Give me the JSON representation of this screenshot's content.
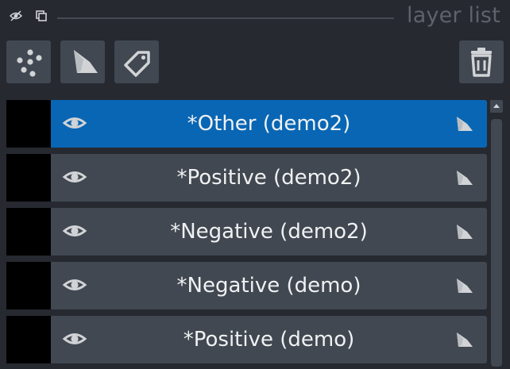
{
  "panel": {
    "title": "layer list",
    "header_icons": [
      "visibility-toggle-icon",
      "float-window-icon"
    ]
  },
  "toolbar": {
    "buttons": [
      {
        "name": "new-points-layer-button",
        "icon": "points-icon"
      },
      {
        "name": "new-shapes-layer-button",
        "icon": "shape-polygon-icon"
      },
      {
        "name": "new-labels-layer-button",
        "icon": "tag-icon"
      }
    ],
    "delete_icon": "trash-icon"
  },
  "layers": [
    {
      "name": "*Other (demo2)",
      "visible": true,
      "selected": true,
      "type_icon": "shape-polygon-icon"
    },
    {
      "name": "*Positive (demo2)",
      "visible": true,
      "selected": false,
      "type_icon": "shape-polygon-icon"
    },
    {
      "name": "*Negative (demo2)",
      "visible": true,
      "selected": false,
      "type_icon": "shape-polygon-icon"
    },
    {
      "name": "*Negative (demo)",
      "visible": true,
      "selected": false,
      "type_icon": "shape-polygon-icon"
    },
    {
      "name": "*Positive (demo)",
      "visible": true,
      "selected": false,
      "type_icon": "shape-polygon-icon"
    }
  ],
  "colors": {
    "background": "#262930",
    "button": "#414851",
    "selected": "#0866b4",
    "text": "#f0f1f2",
    "title": "#5d626b",
    "icon": "#d1d3d6"
  }
}
